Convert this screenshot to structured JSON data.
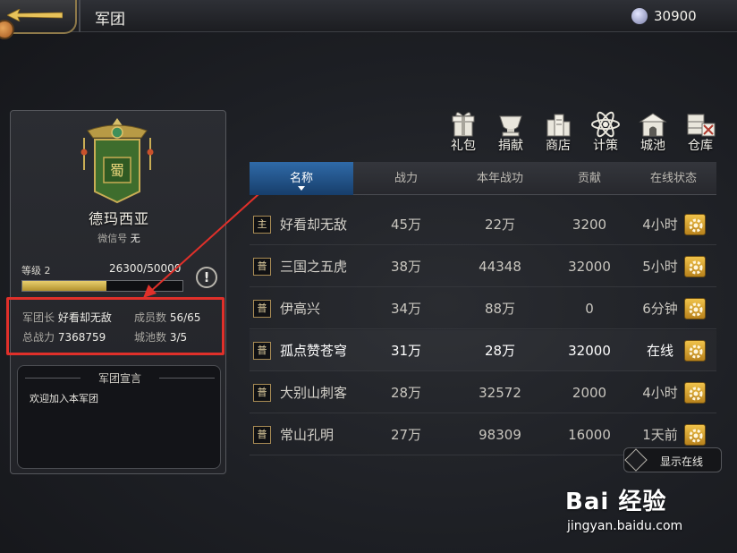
{
  "header": {
    "title": "军团",
    "currency_icon": "diamond-icon",
    "currency_value": "30900"
  },
  "guild": {
    "name": "德玛西亚",
    "emblem_char": "蜀",
    "wechat_label": "微信号",
    "wechat_value": "无",
    "level_label": "等级",
    "level_value": "2",
    "xp_text": "26300/50000",
    "xp_fraction": 0.526,
    "leader_label": "军团长",
    "leader_value": "好看却无敌",
    "members_label": "成员数",
    "members_value": "56/65",
    "power_label": "总战力",
    "power_value": "7368759",
    "cities_label": "城池数",
    "cities_value": "3/5",
    "declaration_title": "军团宣言",
    "declaration_text": "欢迎加入本军团",
    "highlight_color": "#e0302a"
  },
  "actions": [
    {
      "label": "礼包",
      "icon": "gift-icon"
    },
    {
      "label": "捐献",
      "icon": "donate-icon"
    },
    {
      "label": "商店",
      "icon": "shop-icon"
    },
    {
      "label": "计策",
      "icon": "strategy-icon"
    },
    {
      "label": "城池",
      "icon": "city-icon"
    },
    {
      "label": "仓库",
      "icon": "warehouse-icon"
    }
  ],
  "table": {
    "columns": [
      "名称",
      "战力",
      "本年战功",
      "贡献",
      "在线状态"
    ],
    "rows": [
      {
        "rank": "主",
        "name": "好看却无敌",
        "power": "45万",
        "merit": "22万",
        "contrib": "3200",
        "status": "4小时"
      },
      {
        "rank": "普",
        "name": "三国之五虎",
        "power": "38万",
        "merit": "44348",
        "contrib": "32000",
        "status": "5小时"
      },
      {
        "rank": "普",
        "name": "伊高兴",
        "power": "34万",
        "merit": "88万",
        "contrib": "0",
        "status": "6分钟"
      },
      {
        "rank": "普",
        "name": "孤点赞苍穹",
        "power": "31万",
        "merit": "28万",
        "contrib": "32000",
        "status": "在线"
      },
      {
        "rank": "普",
        "name": "大别山刺客",
        "power": "28万",
        "merit": "32572",
        "contrib": "2000",
        "status": "4小时"
      },
      {
        "rank": "普",
        "name": "常山孔明",
        "power": "27万",
        "merit": "98309",
        "contrib": "16000",
        "status": "1天前"
      }
    ]
  },
  "footer": {
    "toggle_label": "显示在线",
    "watermark_logo": "Bai 经验",
    "watermark_url": "jingyan.baidu.com"
  }
}
